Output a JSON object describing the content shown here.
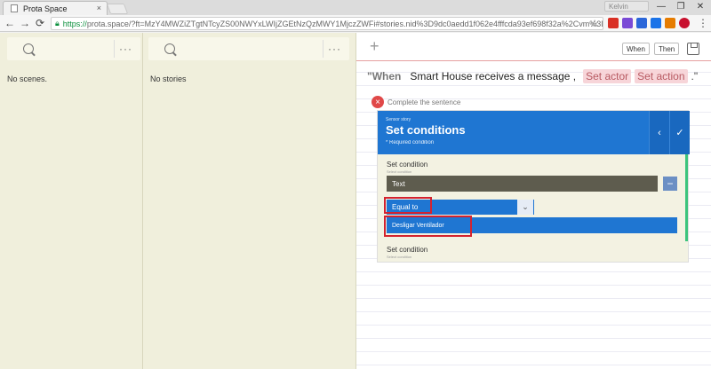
{
  "browser": {
    "tab_title": "Prota Space",
    "tab_close": "×",
    "profile_label": "Kelvin",
    "url_scheme": "https://",
    "url_rest": "prota.space/?ft=MzY4MWZiZTgtNTcyZS00NWYxLWIjZGEtNzQzMWY1MjczZWFi#stories.nid%3D9dc0aedd1f062e4fffcda93ef698f32a%2Cvm%3Div",
    "star": "☆",
    "menu": "⋮",
    "nav_back": "←",
    "nav_forward": "→",
    "reload": "⟳",
    "window_minimize": "—",
    "window_restore": "❐",
    "window_close": "✕"
  },
  "scenes": {
    "dots": "···",
    "empty_text": "No scenes."
  },
  "stories": {
    "dots": "···",
    "empty_text": "No stories"
  },
  "main": {
    "plus": "+",
    "when_button": "When",
    "then_button": "Then",
    "sentence": {
      "when": "\"When",
      "actor": "Smart House receives a message ,",
      "set_actor": "Set actor",
      "set_action": "Set action",
      "end": ".\""
    },
    "complete_label": "Complete the sentence",
    "close_glyph": "×",
    "panel": {
      "small_label": "Sensor story",
      "title": "Set conditions",
      "required": "* Required condition",
      "back_glyph": "‹",
      "check_glyph": "✓",
      "condition_label": "Set condition",
      "condition_sub": "Select condition",
      "text_field": "Text",
      "minus": "−",
      "select_value": "Equal to",
      "caret": "⌄",
      "option_value": "Desligar Ventilador",
      "condition2_label": "Set condition",
      "condition2_sub": "Select condition"
    }
  },
  "colors": {
    "accent_blue": "#1f76d2",
    "highlight_red": "#d4232f",
    "pill_bg": "#f7d5d9",
    "green_bar": "#3cc47c"
  }
}
